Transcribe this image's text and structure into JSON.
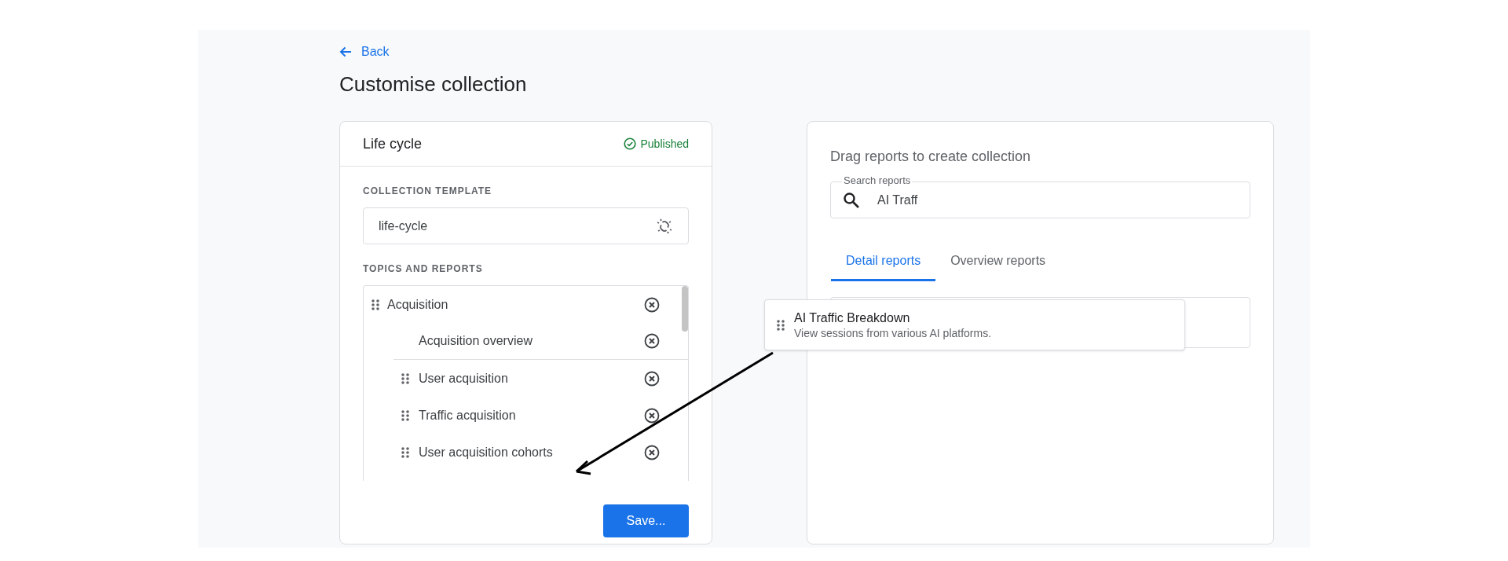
{
  "back_link": {
    "label": "Back"
  },
  "page_title": "Customise collection",
  "collection_card": {
    "name": "Life cycle",
    "status": {
      "label": "Published",
      "published": true
    },
    "template_label": "COLLECTION TEMPLATE",
    "template_value": "life-cycle",
    "topics_label": "TOPICS AND REPORTS",
    "topics": [
      {
        "label": "Acquisition",
        "children": [
          {
            "label": "Acquisition overview",
            "draggable": false
          },
          {
            "label": "User acquisition",
            "draggable": true
          },
          {
            "label": "Traffic acquisition",
            "draggable": true
          },
          {
            "label": "User acquisition cohorts",
            "draggable": true
          }
        ]
      }
    ],
    "save_button": "Save..."
  },
  "reports_panel": {
    "title": "Drag reports to create collection",
    "search": {
      "label": "Search reports",
      "value": "AI Traff"
    },
    "tabs": [
      {
        "label": "Detail reports",
        "selected": true
      },
      {
        "label": "Overview reports",
        "selected": false
      }
    ]
  },
  "dragged_report": {
    "title": "AI Traffic Breakdown",
    "description": "View sessions from various AI platforms."
  }
}
